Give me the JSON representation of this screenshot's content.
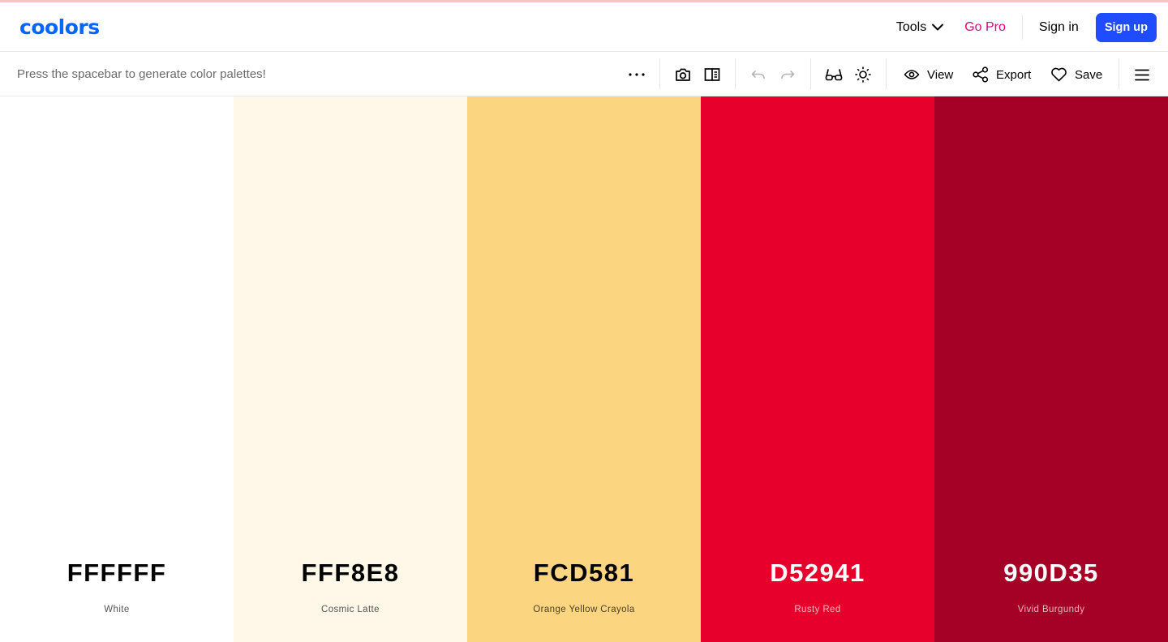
{
  "header": {
    "logo": "coolors",
    "tools_label": "Tools",
    "gopro_label": "Go Pro",
    "signin_label": "Sign in",
    "signup_label": "Sign up"
  },
  "toolbar": {
    "hint": "Press the spacebar to generate color palettes!",
    "view_label": "View",
    "export_label": "Export",
    "save_label": "Save",
    "icons": [
      "more-icon",
      "camera-icon",
      "side-panel-icon",
      "undo-icon",
      "redo-icon",
      "glasses-icon",
      "sun-icon",
      "eye-icon",
      "share-icon",
      "heart-icon",
      "hamburger-menu-icon"
    ]
  },
  "palette": [
    {
      "hex": "FFFFFF",
      "name": "White",
      "color": "#FFFFFF",
      "text_color": "#000000",
      "name_color": "#555555"
    },
    {
      "hex": "FFF8E8",
      "name": "Cosmic Latte",
      "color": "#FFF8E8",
      "text_color": "#000000",
      "name_color": "#555555"
    },
    {
      "hex": "FCD581",
      "name": "Orange Yellow Crayola",
      "color": "#FCD581",
      "text_color": "#000000",
      "name_color": "#4f4023"
    },
    {
      "hex": "D52941",
      "name": "Rusty Red",
      "color": "#E8002C",
      "text_color": "#FFFFFF",
      "name_color": "#f5b6be"
    },
    {
      "hex": "990D35",
      "name": "Vivid Burgundy",
      "color": "#A50026",
      "text_color": "#FFFFFF",
      "name_color": "#e6b3bf"
    }
  ],
  "colors": {
    "brand": "#0066FF",
    "signup": "#1F4CFF",
    "gopro": "#E6007E"
  }
}
